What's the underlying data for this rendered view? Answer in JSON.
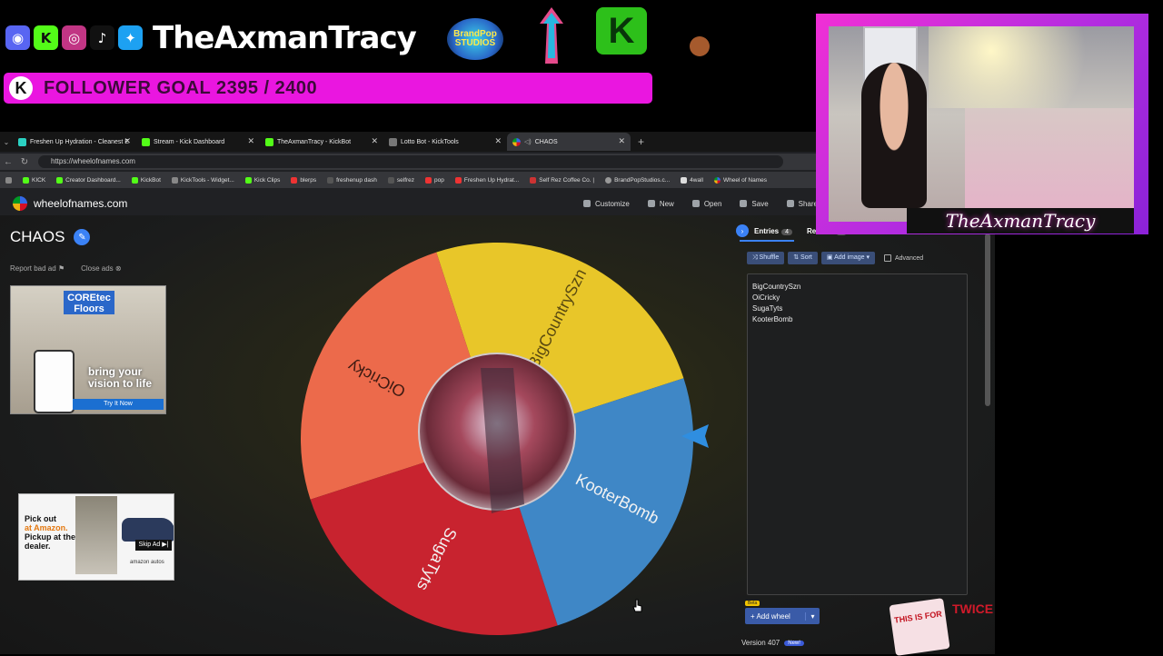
{
  "overlay": {
    "handle": "TheAxmanTracy",
    "brand_logo_text": "BrandPop STUDIOS",
    "kick_logo_letter": "K",
    "follower_goal": "FOLLOWER GOAL 2395 / 2400",
    "social_icons": [
      "discord-icon",
      "kick-icon",
      "instagram-icon",
      "tiktok-icon",
      "twitter-icon"
    ]
  },
  "browser": {
    "tabs": [
      {
        "label": "Freshen Up Hydration - Cleanest E",
        "active": false
      },
      {
        "label": "Stream - Kick Dashboard",
        "active": false
      },
      {
        "label": "TheAxmanTracy - KickBot",
        "active": false
      },
      {
        "label": "Lotto Bot - KickTools",
        "active": false
      },
      {
        "label": "CHAOS",
        "active": true
      }
    ],
    "url": "https://wheelofnames.com",
    "bookmarks": [
      "KICK",
      "Creator Dashboard...",
      "KickBot",
      "KickTools - Widget...",
      "Kick Clips",
      "blerps",
      "freshenup dash",
      "selfrez",
      "pop",
      "Freshen Up Hydrat...",
      "Self Rez Coffee Co. |",
      "BrandPopStudios.c...",
      "4wall",
      "Wheel of Names"
    ]
  },
  "app": {
    "site_name": "wheelofnames.com",
    "menu": [
      "Customize",
      "New",
      "Open",
      "Save",
      "Share"
    ],
    "wheel_title": "CHAOS",
    "report_ad": "Report bad ad",
    "close_ads": "Close ads"
  },
  "ads": {
    "ad1_brand": "COREtec Floors",
    "ad1_copy": "bring your vision to life",
    "ad1_cta": "Try It Now",
    "ad2_copy_1": "Pick out",
    "ad2_copy_2": "at Amazon.",
    "ad2_copy_3": "Pickup at the dealer.",
    "ad2_skip": "Skip Ad ▶|",
    "ad2_amazon": "amazon autos"
  },
  "wheel": {
    "entries": [
      "BigCountrySzn",
      "OiCricky",
      "SugaTyts",
      "KooterBomb"
    ],
    "colors": {
      "BigCountrySzn": "#e8c629",
      "KooterBomb": "#3f87c6",
      "SugaTyts": "#c8232f",
      "OiCricky": "#ec6a4b"
    }
  },
  "panel": {
    "entries_tab": "Entries",
    "entries_count": "4",
    "results_tab": "Results",
    "results_count": "0",
    "shuffle": "Shuffle",
    "sort": "Sort",
    "add_image": "Add image",
    "advanced": "Advanced",
    "entry_list": [
      "BigCountrySzn",
      "OiCricky",
      "SugaTyts",
      "KooterBomb"
    ],
    "beta": "Beta",
    "add_wheel": "Add wheel",
    "version": "Version 407",
    "new_badge": "New!"
  },
  "webcam": {
    "name_tag": "TheAxmanTracy"
  },
  "sticker": {
    "text": "THIS IS FOR",
    "side_text": "TWICE"
  }
}
